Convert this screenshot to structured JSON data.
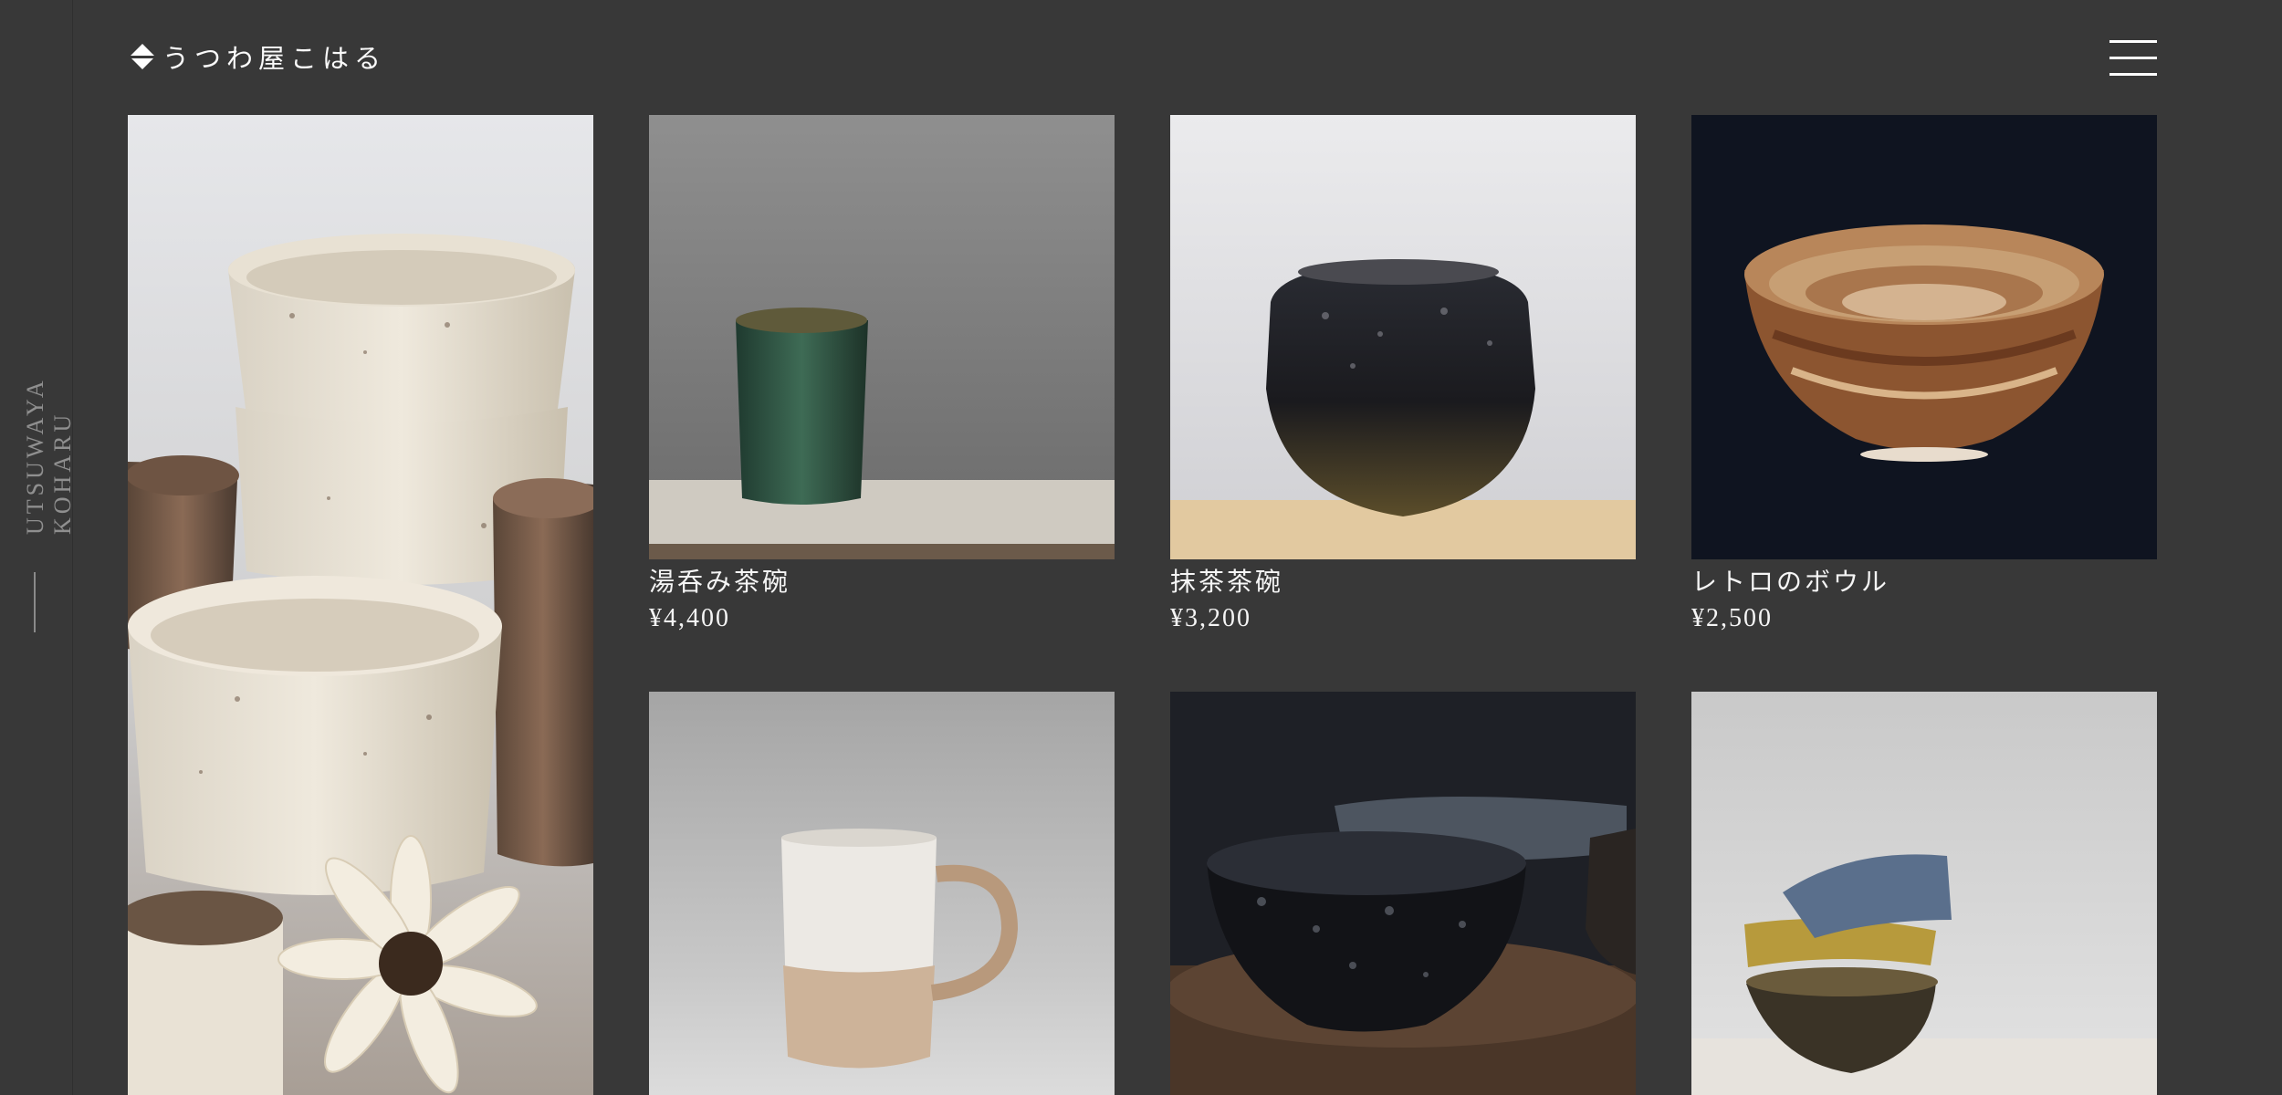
{
  "brand": {
    "name": "うつわ屋こはる",
    "vertical_label": "UTSUWAYA KOHARU",
    "logo_icon": "diamond-logo-icon"
  },
  "header": {
    "menu_icon": "hamburger-menu-icon"
  },
  "colors": {
    "background": "#383838",
    "text": "#f5f5f5",
    "muted": "#8f8f8f"
  },
  "hero": {
    "image": "stacked-ceramic-cups-with-flower"
  },
  "products": [
    {
      "name": "湯呑み茶碗",
      "price": "¥4,400",
      "image": "green-ceramic-yunomi-cup"
    },
    {
      "name": "抹茶茶碗",
      "price": "¥3,200",
      "image": "black-speckled-matcha-bowl"
    },
    {
      "name": "レトロのボウル",
      "price": "¥2,500",
      "image": "brown-striped-retro-bowl"
    },
    {
      "image": "white-beige-ceramic-mug"
    },
    {
      "image": "black-speckled-bowls-on-wood"
    },
    {
      "image": "stacked-glazed-bowls"
    }
  ]
}
